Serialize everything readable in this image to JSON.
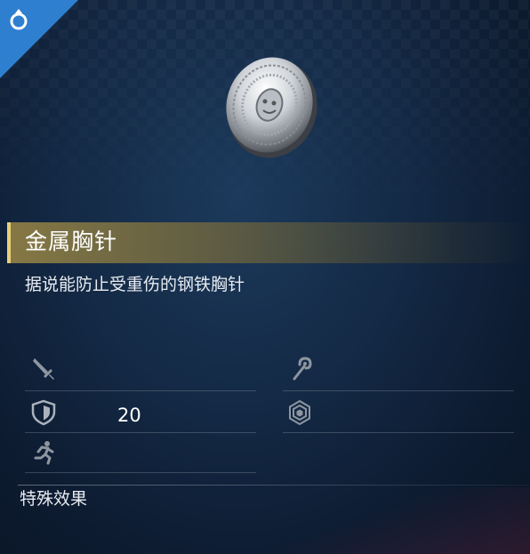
{
  "item": {
    "name": "金属胸针",
    "description": "据说能防止受重伤的钢铁胸针",
    "category_icon": "ring-icon",
    "image": "silver-brooch-image"
  },
  "stats": {
    "attack": {
      "icon": "sword-icon",
      "value": ""
    },
    "magic": {
      "icon": "staff-icon",
      "value": ""
    },
    "defense": {
      "icon": "shield-icon",
      "value": "20"
    },
    "magic_defense": {
      "icon": "hexagon-barrier-icon",
      "value": ""
    },
    "speed": {
      "icon": "running-icon",
      "value": ""
    }
  },
  "special_effects_label": "特殊效果",
  "colors": {
    "accent": "#2f7fd0",
    "name_bar": "#8c7d46",
    "name_bar_edge": "#e9d07a"
  }
}
